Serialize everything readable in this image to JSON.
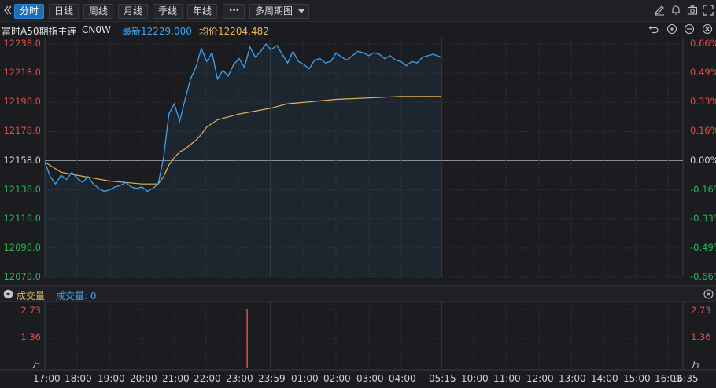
{
  "toolbar": {
    "collapse_icon": "double-chevron-left-icon",
    "tabs": [
      {
        "label": "分时",
        "active": true
      },
      {
        "label": "日线",
        "active": false
      },
      {
        "label": "周线",
        "active": false
      },
      {
        "label": "月线",
        "active": false
      },
      {
        "label": "季线",
        "active": false
      },
      {
        "label": "年线",
        "active": false
      }
    ],
    "more_label": "•••",
    "period_select": "多周期图",
    "right_icons": [
      "pencil-icon",
      "bell-icon",
      "camera-icon",
      "expand-icon"
    ]
  },
  "info": {
    "name": "富时A50期指主连",
    "code": "CN0W",
    "latest": "最新12229.000",
    "average": "均价12204.482",
    "right_icons": [
      "undo-icon",
      "zoom-in-icon",
      "zoom-out-icon",
      "close-circle-icon"
    ]
  },
  "colors": {
    "up": "#e84b4b",
    "down": "#2fb45a",
    "flat": "#d6d8dc",
    "price_line": "#3fa3f0",
    "avg_line": "#e6b15a",
    "accent": "#1f6fb6"
  },
  "volume_panel": {
    "toggle_icon": "chevron-down-circle-icon",
    "title": "成交量",
    "value": "成交量: 0",
    "close_icon": "close-circle-icon",
    "y_labels": [
      "2.73",
      "1.36",
      "万"
    ]
  },
  "chart_data": {
    "type": "line",
    "title": "",
    "xlabel": "",
    "ylabel": "",
    "ylim": [
      12078.0,
      12238.0
    ],
    "base_price": 12158.0,
    "y_ticks_left": [
      "12238.0",
      "12218.0",
      "12198.0",
      "12178.0",
      "12158.0",
      "12138.0",
      "12118.0",
      "12098.0",
      "12078.0"
    ],
    "y_ticks_right": [
      "0.66%",
      "0.49%",
      "0.33%",
      "0.16%",
      "0.00%",
      "-0.16%",
      "-0.33%",
      "-0.49%",
      "-0.66%"
    ],
    "x_ticks": [
      "17:00",
      "18:00",
      "19:00",
      "20:00",
      "21:00",
      "22:00",
      "23:00",
      "23:59",
      "01:00",
      "02:00",
      "03:00",
      "04:00",
      "05:15",
      "10:00",
      "11:00",
      "12:00",
      "13:00",
      "14:00",
      "15:00",
      "16:00",
      "16:35"
    ],
    "series": [
      {
        "key": "price",
        "x": [
          "17:00",
          "17:10",
          "17:20",
          "17:30",
          "17:40",
          "17:50",
          "18:00",
          "18:10",
          "18:20",
          "18:30",
          "18:40",
          "18:50",
          "19:00",
          "19:10",
          "19:20",
          "19:30",
          "19:40",
          "19:50",
          "20:00",
          "20:10",
          "20:20",
          "20:30",
          "20:40",
          "20:50",
          "21:00",
          "21:10",
          "21:20",
          "21:30",
          "21:40",
          "21:50",
          "22:00",
          "22:10",
          "22:20",
          "22:30",
          "22:40",
          "22:50",
          "23:00",
          "23:10",
          "23:20",
          "23:30",
          "23:40",
          "23:50",
          "23:59",
          "00:10",
          "00:20",
          "00:30",
          "00:40",
          "00:50",
          "01:00",
          "01:10",
          "01:20",
          "01:30",
          "01:40",
          "01:50",
          "02:00",
          "02:10",
          "02:20",
          "02:30",
          "02:40",
          "02:50",
          "03:00",
          "03:10",
          "03:20",
          "03:30",
          "03:40",
          "03:50",
          "04:00",
          "04:10",
          "04:20",
          "04:30",
          "04:40",
          "04:50",
          "05:00",
          "05:15"
        ],
        "values": [
          12157,
          12147,
          12142,
          12148,
          12145,
          12150,
          12146,
          12143,
          12147,
          12142,
          12139,
          12137,
          12138,
          12140,
          12141,
          12143,
          12140,
          12139,
          12140,
          12137,
          12139,
          12142,
          12160,
          12190,
          12197,
          12185,
          12200,
          12214,
          12222,
          12235,
          12226,
          12232,
          12214,
          12220,
          12216,
          12224,
          12228,
          12222,
          12236,
          12229,
          12233,
          12238,
          12234,
          12237,
          12231,
          12225,
          12233,
          12226,
          12224,
          12221,
          12227,
          12228,
          12225,
          12226,
          12232,
          12229,
          12227,
          12230,
          12233,
          12232,
          12230,
          12232,
          12231,
          12228,
          12230,
          12227,
          12226,
          12223,
          12226,
          12225,
          12229,
          12230,
          12231,
          12229
        ]
      },
      {
        "key": "average",
        "x": [
          "17:00",
          "17:30",
          "18:00",
          "18:30",
          "19:00",
          "19:30",
          "20:00",
          "20:30",
          "20:40",
          "20:50",
          "21:00",
          "21:10",
          "21:20",
          "21:30",
          "21:40",
          "21:50",
          "22:00",
          "22:20",
          "22:40",
          "23:00",
          "23:30",
          "23:59",
          "00:30",
          "01:00",
          "01:30",
          "02:00",
          "03:00",
          "04:00",
          "05:15"
        ],
        "values": [
          12157,
          12150,
          12148,
          12146,
          12144,
          12143,
          12142,
          12142,
          12147,
          12155,
          12160,
          12164,
          12166,
          12169,
          12172,
          12176,
          12181,
          12186,
          12188,
          12190,
          12192,
          12194,
          12197,
          12198,
          12199,
          12200,
          12201,
          12202,
          12202
        ]
      }
    ],
    "volume": {
      "max": 2.73,
      "spike_x": "23:15",
      "spike_value": 2.73
    }
  }
}
